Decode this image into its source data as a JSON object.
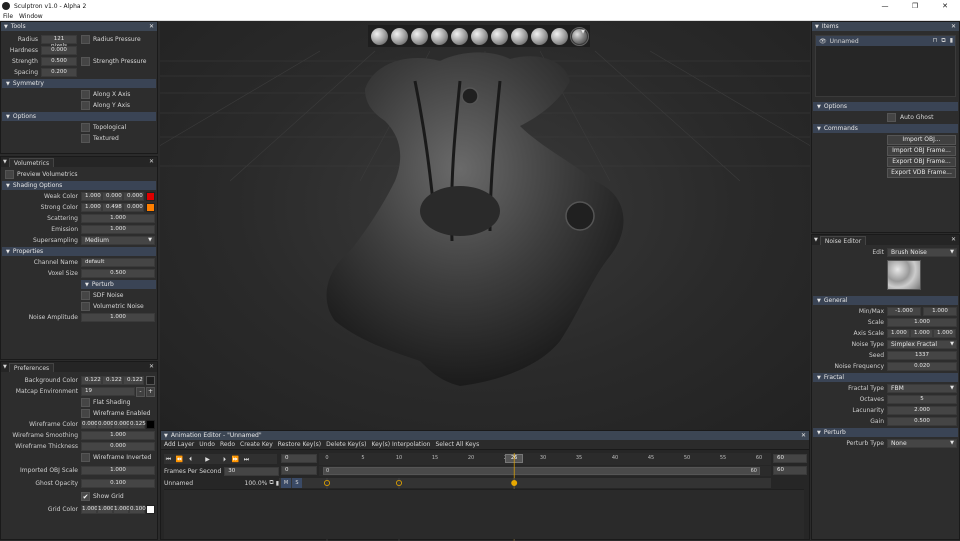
{
  "window": {
    "title": "Sculptron v1.0 - Alpha 2"
  },
  "menu": [
    "File",
    "Window"
  ],
  "tools_panel": {
    "title": "Tools",
    "radius_label": "Radius",
    "radius_value": "121 pixels",
    "radius_pressure": "Radius Pressure",
    "hardness_label": "Hardness",
    "hardness_value": "0.000",
    "strength_label": "Strength",
    "strength_value": "0.500",
    "strength_pressure": "Strength Pressure",
    "spacing_label": "Spacing",
    "spacing_value": "0.200",
    "symmetry_header": "Symmetry",
    "along_x": "Along X Axis",
    "along_y": "Along Y Axis",
    "options_header": "Options",
    "topological": "Topological",
    "textured": "Textured"
  },
  "volumetrics_panel": {
    "title": "Volumetrics",
    "preview": "Preview Volumetrics",
    "shading_header": "Shading Options",
    "weak_color_label": "Weak Color",
    "weak_color": [
      "1.000",
      "0.000",
      "0.000"
    ],
    "weak_swatch": "#e00000",
    "strong_color_label": "Strong Color",
    "strong_color": [
      "1.000",
      "0.498",
      "0.000"
    ],
    "strong_swatch": "#ff7f00",
    "scattering_label": "Scattering",
    "scattering_value": "1.000",
    "emission_label": "Emission",
    "emission_value": "1.000",
    "supersampling_label": "Supersampling",
    "supersampling_value": "Medium",
    "properties_header": "Properties",
    "channel_name_label": "Channel Name",
    "channel_name_value": "default",
    "voxel_size_label": "Voxel Size",
    "voxel_size_value": "0.500",
    "perturb_header": "Perturb",
    "sdf_noise": "SDF Noise",
    "volumetric_noise": "Volumetric Noise",
    "noise_amplitude_label": "Noise Amplitude",
    "noise_amplitude_value": "1.000"
  },
  "preferences_panel": {
    "title": "Preferences",
    "background_color_label": "Background Color",
    "background_color": [
      "0.122",
      "0.122",
      "0.122"
    ],
    "background_swatch": "#1f1f1f",
    "matcap_label": "Matcap Environment",
    "matcap_value": "19",
    "minus": "-",
    "plus": "+",
    "flat_shading": "Flat Shading",
    "wireframe_enabled": "Wireframe Enabled",
    "wireframe_color_label": "Wireframe Color",
    "wireframe_color": [
      "0.000",
      "0.000",
      "0.000",
      "0.125"
    ],
    "wireframe_swatch": "#000000",
    "wireframe_smoothing_label": "Wireframe Smoothing",
    "wireframe_smoothing_value": "1.000",
    "wireframe_thickness_label": "Wireframe Thickness",
    "wireframe_thickness_value": "0.000",
    "wireframe_inverted": "Wireframe Inverted",
    "imported_obj_scale_label": "Imported OBJ Scale",
    "imported_obj_scale_value": "1.000",
    "ghost_opacity_label": "Ghost Opacity",
    "ghost_opacity_value": "0.100",
    "show_grid": "Show Grid",
    "grid_color_label": "Grid Color",
    "grid_color": [
      "1.000",
      "1.000",
      "1.000",
      "0.100"
    ],
    "grid_swatch": "#ffffff"
  },
  "items_panel": {
    "title": "Items",
    "item_name": "Unnamed",
    "options_header": "Options",
    "auto_ghost": "Auto Ghost",
    "commands_header": "Commands",
    "import_obj": "Import OBJ...",
    "import_obj_frame": "Import OBJ Frame...",
    "export_obj_frame": "Export OBJ Frame...",
    "export_vdb_frame": "Export VDB Frame..."
  },
  "noise_panel": {
    "title": "Noise Editor",
    "edit_label": "Edit",
    "edit_value": "Brush Noise",
    "general_header": "General",
    "minmax_label": "Min/Max",
    "min_value": "-1.000",
    "max_value": "1.000",
    "scale_label": "Scale",
    "scale_value": "1.000",
    "axis_scale_label": "Axis Scale",
    "axis_scale": [
      "1.000",
      "1.000",
      "1.000"
    ],
    "noise_type_label": "Noise Type",
    "noise_type_value": "Simplex Fractal",
    "seed_label": "Seed",
    "seed_value": "1337",
    "noise_freq_label": "Noise Frequency",
    "noise_freq_value": "0.020",
    "fractal_header": "Fractal",
    "fractal_type_label": "Fractal Type",
    "fractal_type_value": "FBM",
    "octaves_label": "Octaves",
    "octaves_value": "5",
    "lacunarity_label": "Lacunarity",
    "lacunarity_value": "2.000",
    "gain_label": "Gain",
    "gain_value": "0.500",
    "perturb_header": "Perturb",
    "perturb_type_label": "Perturb Type",
    "perturb_type_value": "None"
  },
  "animation": {
    "title": "Animation Editor - \"Unnamed\"",
    "menu": [
      "Add Layer",
      "Undo",
      "Redo",
      "Create Key",
      "Restore Key(s)",
      "Delete Key(s)",
      "Key(s) Interpolation",
      "Select All Keys"
    ],
    "fps_label": "Frames Per Second",
    "fps_value": "30",
    "start_top": "0",
    "start_bottom": "0",
    "end_top": "60",
    "end_bottom": "60",
    "ruler": [
      "0",
      "5",
      "10",
      "15",
      "20",
      "25",
      "30",
      "35",
      "40",
      "45",
      "50",
      "55",
      "60"
    ],
    "current_frame": "26",
    "range_start": "0",
    "range_end": "60",
    "layer_name": "Unnamed",
    "layer_opacity": "100.0%",
    "layer_m": "M",
    "layer_s": "S",
    "keyframes": [
      0,
      10,
      26
    ]
  },
  "sculpt_tools": [
    "tool-smooth",
    "tool-inflate",
    "tool-sphere",
    "tool-standard",
    "tool-clay",
    "tool-crease",
    "tool-flatten",
    "tool-pinch",
    "tool-grab",
    "tool-layer",
    "tool-noise"
  ]
}
